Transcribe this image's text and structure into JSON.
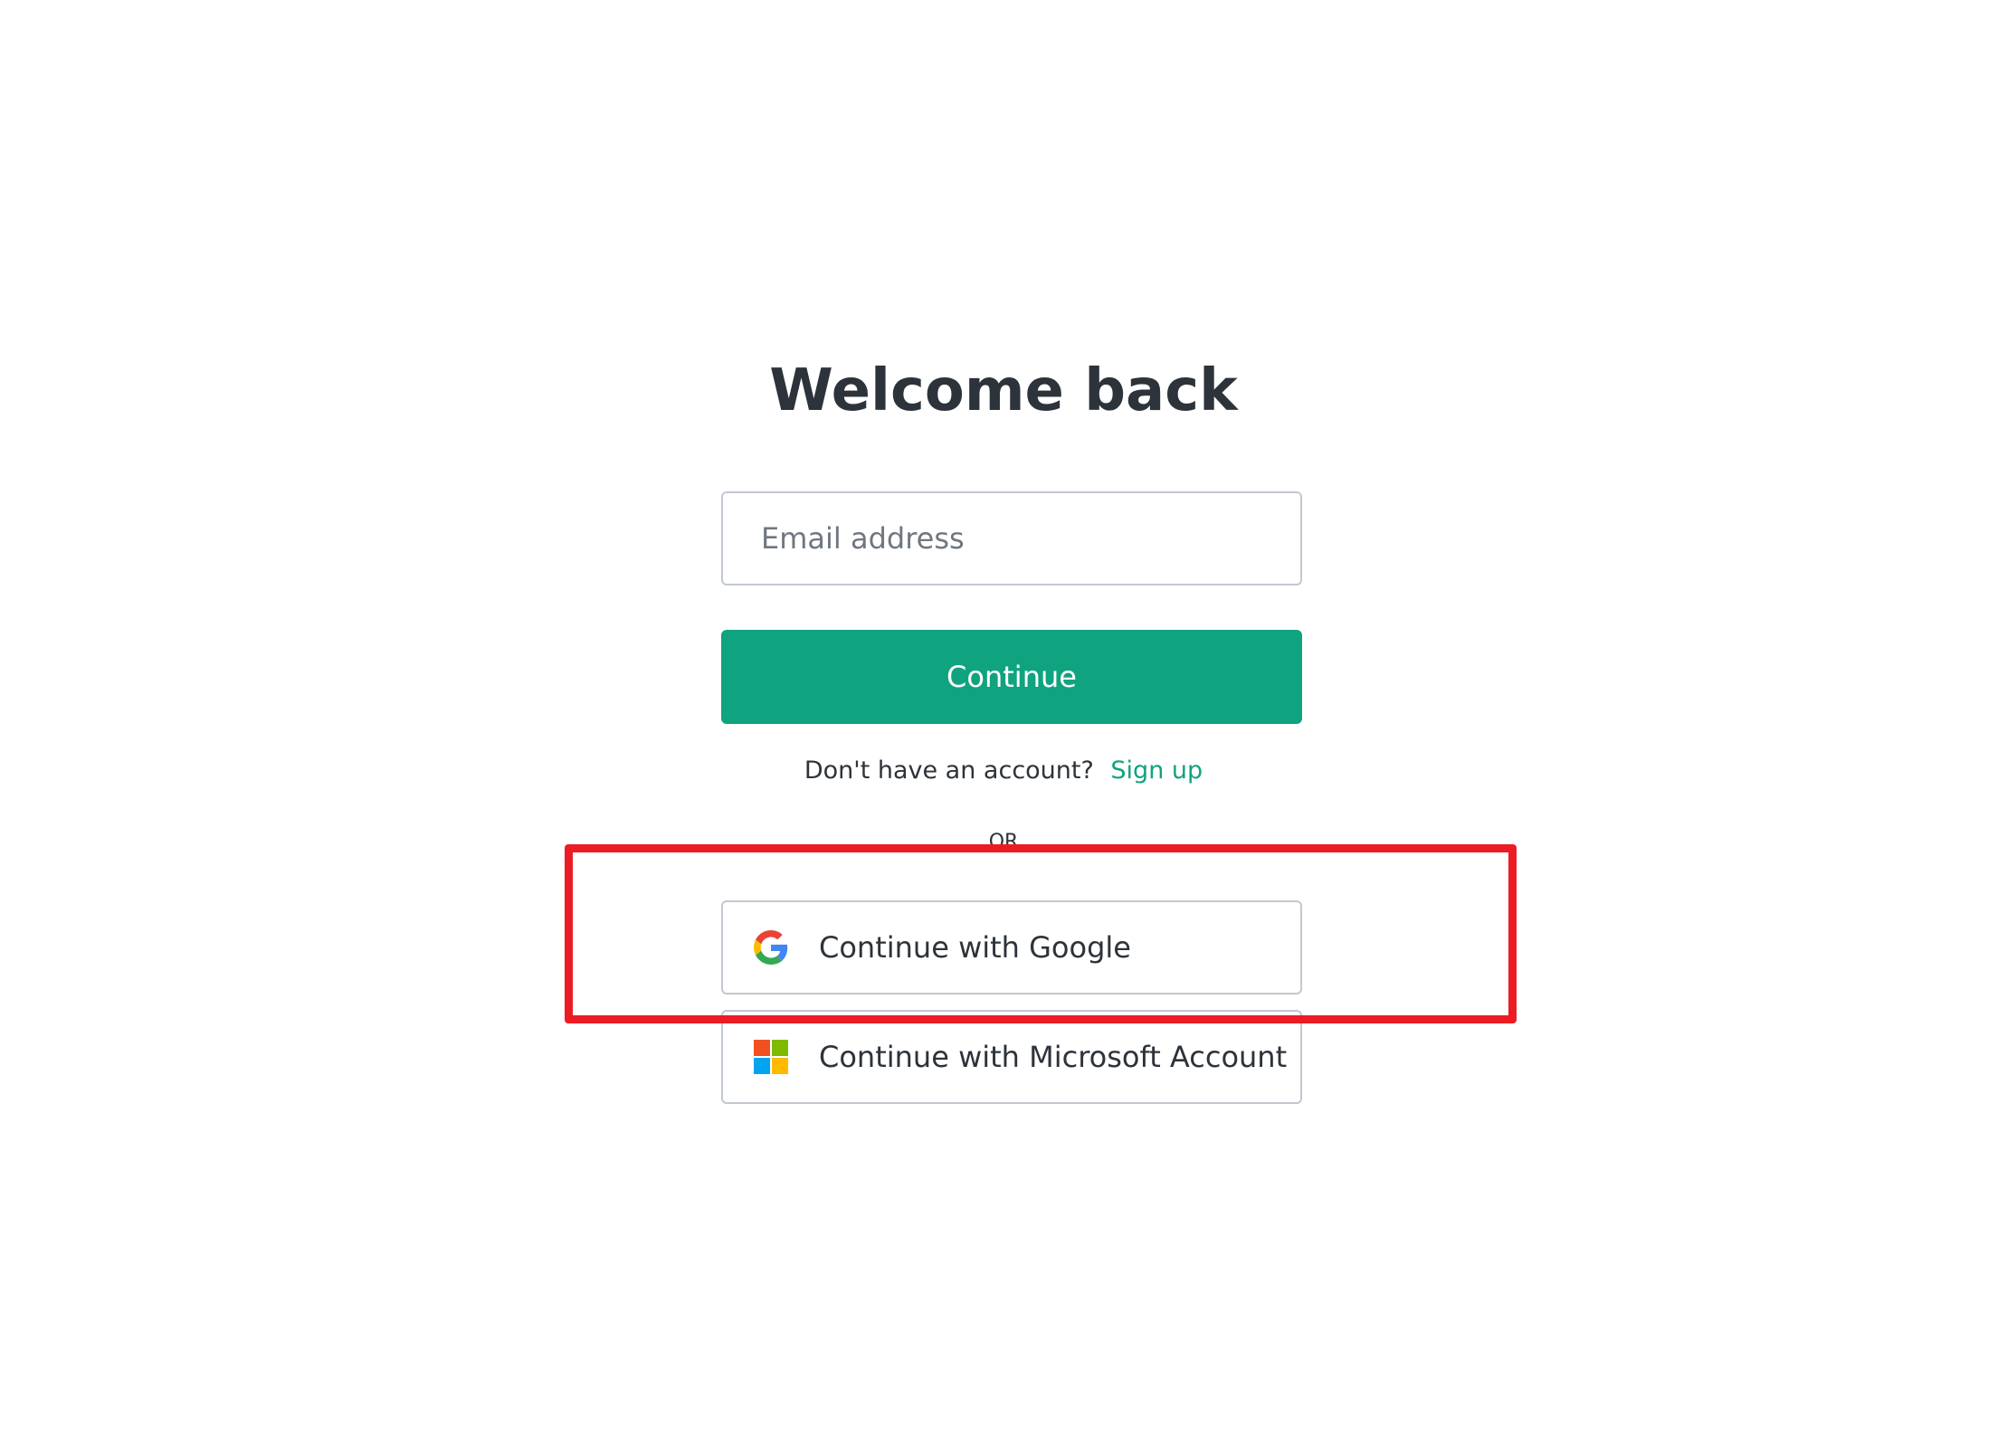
{
  "header": {
    "title": "Welcome back"
  },
  "form": {
    "email_placeholder": "Email address",
    "email_value": "",
    "continue_label": "Continue"
  },
  "signup": {
    "prompt": "Don't have an account?",
    "link_label": "Sign up"
  },
  "divider": {
    "label": "OR"
  },
  "social": {
    "google_label": "Continue with Google",
    "google_icon": "google-icon",
    "microsoft_label": "Continue with Microsoft Account",
    "microsoft_icon": "microsoft-icon"
  },
  "colors": {
    "accent": "#10a37f",
    "text": "#2d333a",
    "border": "#c2c8d0",
    "highlight": "#ec1c24",
    "google_blue": "#4285F4",
    "google_red": "#EA4335",
    "google_yellow": "#FBBC05",
    "google_green": "#34A853",
    "ms_red": "#F25022",
    "ms_green": "#7FBA00",
    "ms_blue": "#00A4EF",
    "ms_yellow": "#FFB900"
  }
}
